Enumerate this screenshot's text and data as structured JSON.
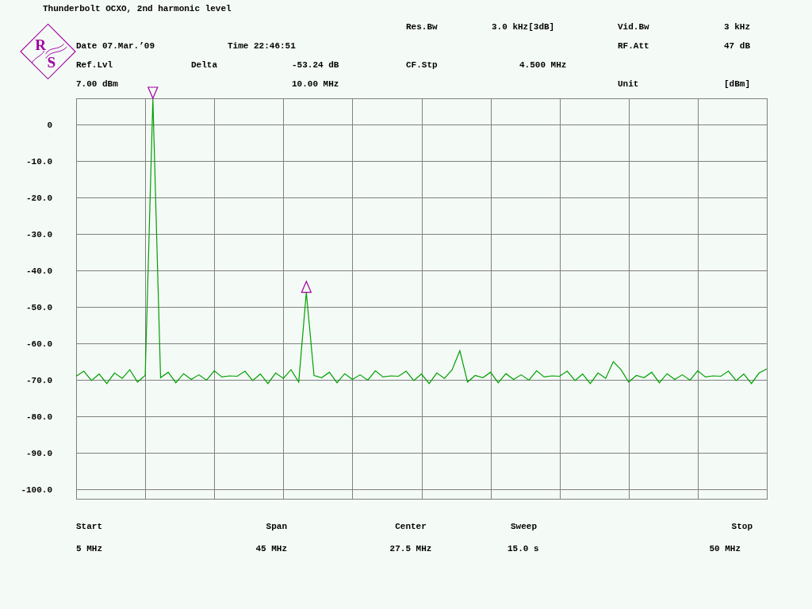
{
  "title": "Thunderbolt OCXO, 2nd harmonic level",
  "logo": [
    "R",
    "S"
  ],
  "res_bw": {
    "label": "Res.Bw",
    "value": "3.0 kHz[3dB]"
  },
  "vid_bw": {
    "label": "Vid.Bw",
    "value": "3 kHz"
  },
  "date": "Date 07.Mar.’09",
  "time": "Time 22:46:51",
  "rf_att": {
    "label": "RF.Att",
    "value": "47 dB"
  },
  "ref_lvl": {
    "label": "Ref.Lvl",
    "value": "7.00 dBm"
  },
  "delta": {
    "label": "Delta",
    "value": "-53.24 dB",
    "frequency": "10.00 MHz"
  },
  "cf_stp": {
    "label": "CF.Stp",
    "value": "4.500 MHz"
  },
  "unit": {
    "label": "Unit",
    "value": "[dBm]"
  },
  "chart_data": {
    "type": "line",
    "grid": true,
    "ylim": [
      -102.6,
      7.2
    ],
    "yticks": [
      {
        "value": 0,
        "label": "0"
      },
      {
        "value": -10,
        "label": "-10.0"
      },
      {
        "value": -20,
        "label": "-20.0"
      },
      {
        "value": -30,
        "label": "-30.0"
      },
      {
        "value": -40,
        "label": "-40.0"
      },
      {
        "value": -50,
        "label": "-50.0"
      },
      {
        "value": -60,
        "label": "-60.0"
      },
      {
        "value": -70,
        "label": "-70.0"
      },
      {
        "value": -80,
        "label": "-80.0"
      },
      {
        "value": -90,
        "label": "-90.0"
      },
      {
        "value": -100,
        "label": "-100.0"
      }
    ],
    "categories": [
      null,
      null,
      null,
      null,
      null,
      null,
      null,
      null,
      null,
      null,
      null,
      null,
      null,
      null,
      null,
      null,
      null,
      null,
      null,
      null,
      null,
      null,
      null,
      null,
      null,
      null,
      null,
      null,
      null,
      null,
      null,
      null,
      null,
      null,
      null,
      null,
      null,
      null,
      null,
      null,
      null,
      null,
      null,
      null,
      null,
      null,
      null,
      null,
      null,
      null,
      null,
      null,
      null,
      null,
      null,
      null,
      null,
      null,
      null,
      null,
      null,
      null,
      null,
      null,
      null,
      null,
      null,
      null,
      null,
      null,
      null,
      null,
      null,
      null,
      null,
      null,
      null,
      null,
      null,
      null,
      null,
      null,
      null,
      null,
      null,
      null,
      null,
      null,
      null,
      null,
      null
    ],
    "series": [
      {
        "color": "#00a000",
        "values": [
          -69,
          -67.6,
          -70.2,
          -68.4,
          -71,
          -68.1,
          -69.6,
          -67.2,
          -70.6,
          -68.8,
          7,
          -69.4,
          -67.9,
          -70.8,
          -68.3,
          -69.9,
          -68.6,
          -70.1,
          -67.5,
          -69.2,
          -68.9,
          -69,
          -67.6,
          -70.2,
          -68.4,
          -71,
          -68.1,
          -69.6,
          -67.2,
          -70.6,
          -46,
          -68.8,
          -69.4,
          -67.9,
          -70.8,
          -68.3,
          -69.9,
          -68.6,
          -70.1,
          -67.5,
          -69.2,
          -68.9,
          -69,
          -67.6,
          -70.2,
          -68.4,
          -71,
          -68.1,
          -69.6,
          -67.2,
          -62,
          -70.6,
          -68.8,
          -69.4,
          -67.9,
          -70.8,
          -68.3,
          -69.9,
          -68.6,
          -70.1,
          -67.5,
          -69.2,
          -68.9,
          -69,
          -67.6,
          -70.2,
          -68.4,
          -71,
          -68.1,
          -69.6,
          -65,
          -67.2,
          -70.6,
          -68.8,
          -69.4,
          -67.9,
          -70.8,
          -68.3,
          -69.9,
          -68.6,
          -70.1,
          -67.5,
          -69.2,
          -68.9,
          -69,
          -67.6,
          -70.2,
          -68.4,
          -71,
          -68.1,
          -67
        ]
      }
    ]
  },
  "markers": [
    {
      "kind": "reference"
    },
    {
      "kind": "delta"
    }
  ],
  "footer": [
    {
      "label": "Start",
      "value": "5 MHz"
    },
    {
      "label": "Span",
      "value": "45 MHz"
    },
    {
      "label": "Center",
      "value": "27.5 MHz"
    },
    {
      "label": "Sweep",
      "value": "15.0 s"
    },
    {
      "label": "Stop",
      "value": "50 MHz"
    }
  ]
}
